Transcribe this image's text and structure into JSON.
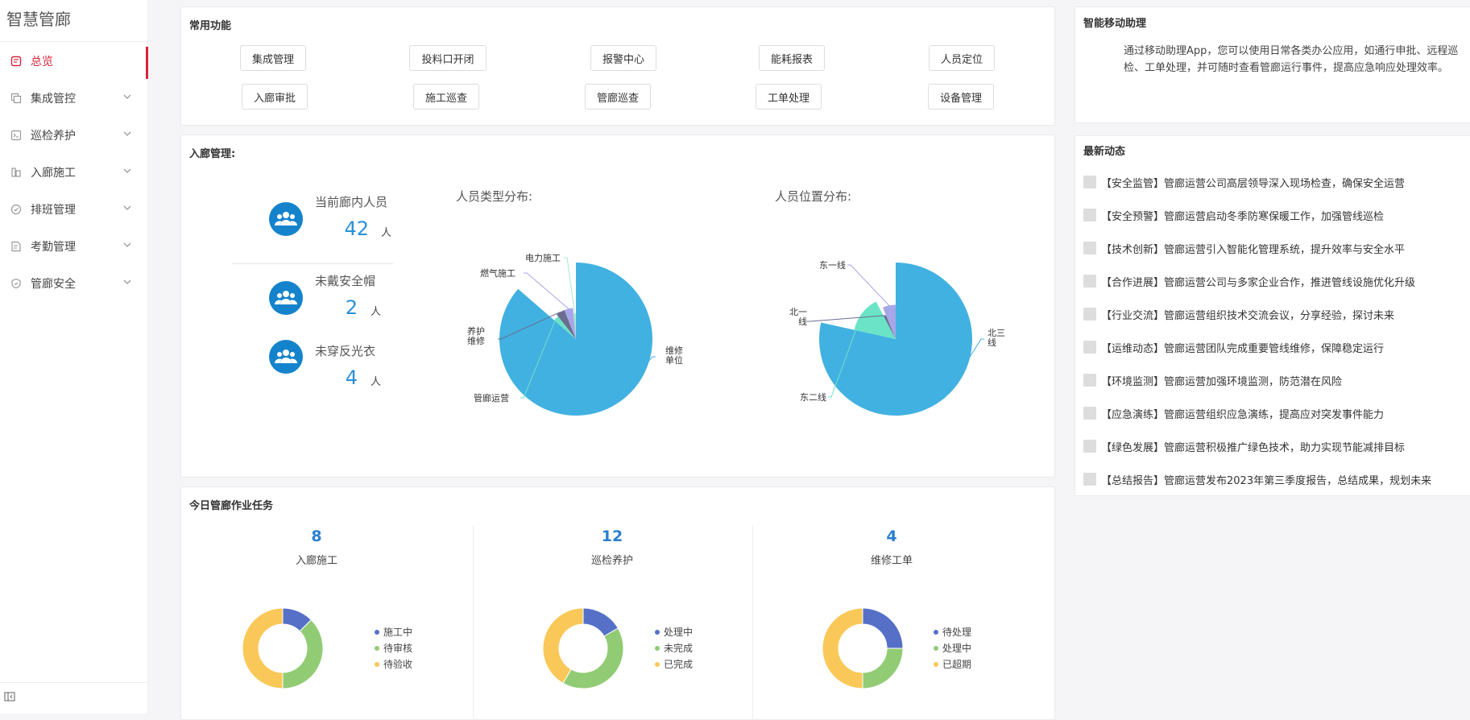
{
  "app": {
    "title": "智慧管廊"
  },
  "sidebar": {
    "items": [
      {
        "label": "总览",
        "icon": "overview-icon",
        "active": true
      },
      {
        "label": "集成管控",
        "icon": "layers-icon"
      },
      {
        "label": "巡检养护",
        "icon": "terminal-icon"
      },
      {
        "label": "入廊施工",
        "icon": "building-icon"
      },
      {
        "label": "排班管理",
        "icon": "check-circle-icon"
      },
      {
        "label": "考勤管理",
        "icon": "edit-doc-icon"
      },
      {
        "label": "管廊安全",
        "icon": "shield-icon"
      }
    ]
  },
  "quick": {
    "title": "常用功能",
    "buttons": [
      "集成管理",
      "投料口开闭",
      "报警中心",
      "能耗报表",
      "人员定位",
      "入廊审批",
      "施工巡查",
      "管廊巡查",
      "工单处理",
      "设备管理"
    ]
  },
  "entry": {
    "title": "入廊管理:",
    "stats": [
      {
        "label": "当前廊内人员",
        "value": "42",
        "unit": "人"
      },
      {
        "label": "未戴安全帽",
        "value": "2",
        "unit": "人"
      },
      {
        "label": "未穿反光衣",
        "value": "4",
        "unit": "人"
      }
    ],
    "type_title": "人员类型分布:",
    "location_title": "人员位置分布:"
  },
  "chart_data": [
    {
      "type": "pie",
      "title": "人员类型分布:",
      "slices": [
        {
          "label": "维修单位",
          "value": 57,
          "color": "#41b1e1"
        },
        {
          "label": "管廊运营",
          "value": 2,
          "color": "#6be3c7"
        },
        {
          "label": "养护维修",
          "value": 3,
          "color": "#6a6d90"
        },
        {
          "label": "燃气施工",
          "value": 3,
          "color": "#a7a6e8"
        },
        {
          "label": "电力施工",
          "value": 1,
          "color": "#a8e8cf"
        }
      ]
    },
    {
      "type": "pie",
      "title": "人员位置分布:",
      "slices": [
        {
          "label": "北三线",
          "value": 51,
          "color": "#41b1e1"
        },
        {
          "label": "东二线",
          "value": 9,
          "color": "#6be3c7"
        },
        {
          "label": "北一线",
          "value": 1,
          "color": "#6a6d90"
        },
        {
          "label": "东一线",
          "value": 4,
          "color": "#a7a6e8"
        }
      ]
    },
    {
      "type": "pie",
      "title": "入廊施工",
      "total": "8",
      "slices": [
        {
          "label": "施工中",
          "value": 1,
          "color": "#5670c8"
        },
        {
          "label": "待审核",
          "value": 3,
          "color": "#91cc75"
        },
        {
          "label": "待验收",
          "value": 4,
          "color": "#fac858"
        }
      ]
    },
    {
      "type": "pie",
      "title": "巡检养护",
      "total": "12",
      "slices": [
        {
          "label": "处理中",
          "value": 2,
          "color": "#5670c8"
        },
        {
          "label": "未完成",
          "value": 5,
          "color": "#91cc75"
        },
        {
          "label": "已完成",
          "value": 5,
          "color": "#fac858"
        }
      ]
    },
    {
      "type": "pie",
      "title": "维修工单",
      "total": "4",
      "slices": [
        {
          "label": "待处理",
          "value": 1,
          "color": "#5670c8"
        },
        {
          "label": "处理中",
          "value": 1,
          "color": "#91cc75"
        },
        {
          "label": "已超期",
          "value": 2,
          "color": "#fac858"
        }
      ]
    }
  ],
  "tasks": {
    "title": "今日管廊作业任务",
    "groups": [
      {
        "num": "8",
        "label": "入廊施工",
        "legend": [
          "施工中",
          "待审核",
          "待验收"
        ]
      },
      {
        "num": "12",
        "label": "巡检养护",
        "legend": [
          "处理中",
          "未完成",
          "已完成"
        ]
      },
      {
        "num": "4",
        "label": "维修工单",
        "legend": [
          "待处理",
          "处理中",
          "已超期"
        ]
      }
    ]
  },
  "assistant": {
    "title": "智能移动助理",
    "text": "通过移动助理App，您可以使用日常各类办公应用，如通行申批、远程巡检、工单处理，并可随时查看管廊运行事件，提高应急响应处理效率。"
  },
  "news": {
    "title": "最新动态",
    "items": [
      "【安全监管】管廊运营公司高层领导深入现场检查，确保安全运营",
      "【安全预警】管廊运营启动冬季防寒保暖工作，加强管线巡检",
      "【技术创新】管廊运营引入智能化管理系统，提升效率与安全水平",
      "【合作进展】管廊运营公司与多家企业合作，推进管线设施优化升级",
      "【行业交流】管廊运营组织技术交流会议，分享经验，探讨未来",
      "【运维动态】管廊运营团队完成重要管线维修，保障稳定运行",
      "【环境监测】管廊运营加强环境监测，防范潜在风险",
      "【应急演练】管廊运营组织应急演练，提高应对突发事件能力",
      "【绿色发展】管廊运营积极推广绿色技术，助力实现节能减排目标",
      "【总结报告】管廊运营发布2023年第三季度报告，总结成果，规划未来"
    ]
  }
}
